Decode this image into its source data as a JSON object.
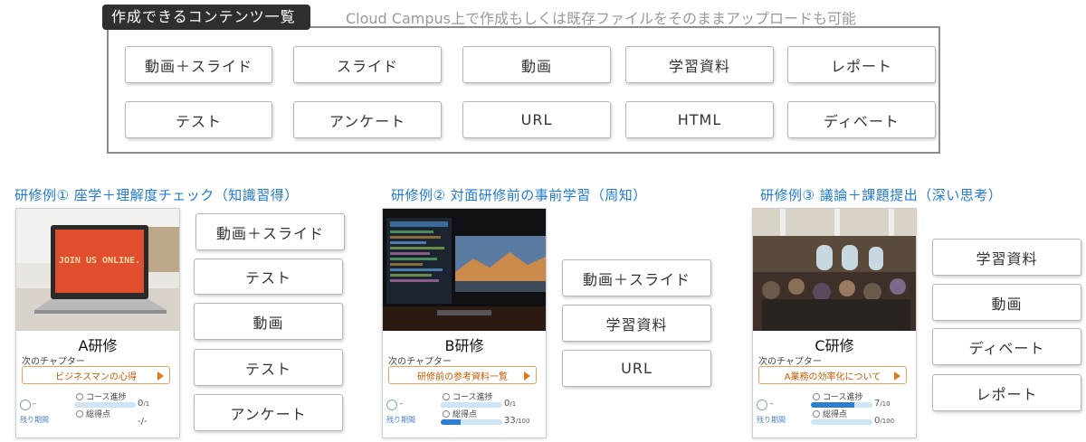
{
  "top": {
    "tag": "作成できるコンテンツ一覧",
    "desc": "Cloud Campus上で作成もしくは既存ファイルをそのままアップロードも可能",
    "items": [
      "動画＋スライド",
      "スライド",
      "動画",
      "学習資料",
      "レポート",
      "テスト",
      "アンケート",
      "URL",
      "HTML",
      "ディベート"
    ]
  },
  "cases": [
    {
      "title": "研修例① 座学＋理解度チェック（知識習得）",
      "card": {
        "name": "A研修",
        "image_text": "JOIN US ONLINE.",
        "chapter_label": "次のチャプター",
        "chapter": "ビジネスマンの心得",
        "remaining_label": "残り期間",
        "remaining": "–",
        "progress_label": "コース進捗",
        "progress_value": "0",
        "progress_total": "/1",
        "progress_ratio": 0,
        "score_label": "総得点",
        "score_value": "-/-",
        "score_ratio": 0
      },
      "items": [
        "動画＋スライド",
        "テスト",
        "動画",
        "テスト",
        "アンケート"
      ]
    },
    {
      "title": "研修例② 対面研修前の事前学習（周知）",
      "card": {
        "name": "B研修",
        "chapter_label": "次のチャプター",
        "chapter": "研修前の参考資料一覧",
        "remaining_label": "残り期間",
        "remaining": "–",
        "progress_label": "コース進捗",
        "progress_value": "0",
        "progress_total": "/1",
        "progress_ratio": 0,
        "score_label": "総得点",
        "score_value": "33",
        "score_total": "/100",
        "score_ratio": 0.33
      },
      "items": [
        "動画＋スライド",
        "学習資料",
        "URL"
      ]
    },
    {
      "title": "研修例③ 議論＋課題提出（深い思考）",
      "card": {
        "name": "C研修",
        "chapter_label": "次のチャプター",
        "chapter": "A業務の効率化について",
        "remaining_label": "残り期間",
        "remaining": "–",
        "progress_label": "コース進捗",
        "progress_value": "7",
        "progress_total": "/10",
        "progress_ratio": 0.7,
        "score_label": "総得点",
        "score_value": "0",
        "score_total": "/100",
        "score_ratio": 0
      },
      "items": [
        "学習資料",
        "動画",
        "ディベート",
        "レポート"
      ]
    }
  ],
  "colors": {
    "title_blue": "#1f7bd6",
    "chapter_orange": "#e07a1a",
    "progress_blue": "#2f7fd1"
  }
}
